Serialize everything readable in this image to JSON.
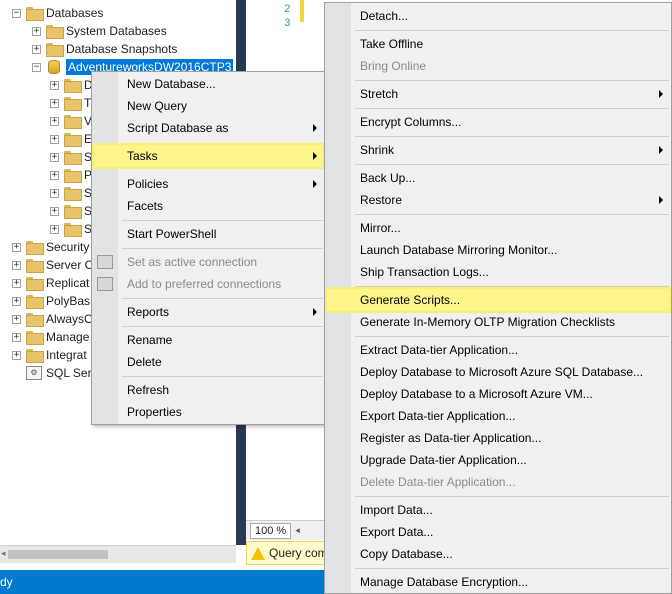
{
  "tree": {
    "nodes": [
      {
        "label": "Databases",
        "expander": "−",
        "icon": "folder-icon"
      },
      {
        "label": "System Databases",
        "expander": "+",
        "icon": "folder-icon"
      },
      {
        "label": "Database Snapshots",
        "expander": "+",
        "icon": "folder-icon"
      },
      {
        "label": "AdventureworksDW2016CTP3",
        "expander": "−",
        "icon": "database-icon"
      },
      {
        "label": "D",
        "expander": "+",
        "icon": "folder-icon"
      },
      {
        "label": "T",
        "expander": "+",
        "icon": "folder-icon"
      },
      {
        "label": "V",
        "expander": "+",
        "icon": "folder-icon"
      },
      {
        "label": "E",
        "expander": "+",
        "icon": "folder-icon"
      },
      {
        "label": "S",
        "expander": "+",
        "icon": "folder-icon"
      },
      {
        "label": "P",
        "expander": "+",
        "icon": "folder-icon"
      },
      {
        "label": "S",
        "expander": "+",
        "icon": "folder-icon"
      },
      {
        "label": "S",
        "expander": "+",
        "icon": "folder-icon"
      },
      {
        "label": "S",
        "expander": "+",
        "icon": "folder-icon"
      },
      {
        "label": "Security",
        "expander": "+",
        "icon": "folder-icon"
      },
      {
        "label": "Server O",
        "expander": "+",
        "icon": "folder-icon"
      },
      {
        "label": "Replicat",
        "expander": "+",
        "icon": "folder-icon"
      },
      {
        "label": "PolyBas",
        "expander": "+",
        "icon": "folder-icon"
      },
      {
        "label": "AlwaysO",
        "expander": "+",
        "icon": "folder-icon"
      },
      {
        "label": "Manage",
        "expander": "+",
        "icon": "folder-icon"
      },
      {
        "label": "Integrat",
        "expander": "+",
        "icon": "folder-icon"
      },
      {
        "label": "SQL Serv",
        "expander": "",
        "icon": "sql-agent-icon"
      }
    ]
  },
  "editor": {
    "line_numbers": [
      "2",
      "3"
    ],
    "zoom": "100 %",
    "query_status": "Query com"
  },
  "status_bar": {
    "text": "dy"
  },
  "context_menu": {
    "items": [
      {
        "label": "New Database..."
      },
      {
        "label": "New Query"
      },
      {
        "label": "Script Database as",
        "submenu": true
      },
      {
        "label": "Tasks",
        "submenu": true,
        "highlighted": true
      },
      {
        "label": "Policies",
        "submenu": true
      },
      {
        "label": "Facets"
      },
      {
        "label": "Start PowerShell"
      },
      {
        "label": "Set as active connection",
        "disabled": true
      },
      {
        "label": "Add to preferred connections",
        "disabled": true
      },
      {
        "label": "Reports",
        "submenu": true
      },
      {
        "label": "Rename"
      },
      {
        "label": "Delete"
      },
      {
        "label": "Refresh"
      },
      {
        "label": "Properties"
      }
    ]
  },
  "tasks_menu": {
    "items": [
      {
        "label": "Detach..."
      },
      {
        "label": "Take Offline"
      },
      {
        "label": "Bring Online",
        "disabled": true
      },
      {
        "label": "Stretch",
        "submenu": true
      },
      {
        "label": "Encrypt Columns..."
      },
      {
        "label": "Shrink",
        "submenu": true
      },
      {
        "label": "Back Up..."
      },
      {
        "label": "Restore",
        "submenu": true
      },
      {
        "label": "Mirror..."
      },
      {
        "label": "Launch Database Mirroring Monitor..."
      },
      {
        "label": "Ship Transaction Logs..."
      },
      {
        "label": "Generate Scripts...",
        "highlighted": true
      },
      {
        "label": "Generate In-Memory OLTP Migration Checklists"
      },
      {
        "label": "Extract Data-tier Application..."
      },
      {
        "label": "Deploy Database to Microsoft Azure SQL Database..."
      },
      {
        "label": "Deploy Database to a Microsoft Azure VM..."
      },
      {
        "label": "Export Data-tier Application..."
      },
      {
        "label": "Register as Data-tier Application..."
      },
      {
        "label": "Upgrade Data-tier Application..."
      },
      {
        "label": "Delete Data-tier Application...",
        "disabled": true
      },
      {
        "label": "Import Data..."
      },
      {
        "label": "Export Data..."
      },
      {
        "label": "Copy Database..."
      },
      {
        "label": "Manage Database Encryption..."
      }
    ]
  },
  "colors": {
    "highlight": "#fbf58a",
    "status_bar": "#007acc",
    "selection": "#0078d7",
    "splitter": "#293955"
  }
}
